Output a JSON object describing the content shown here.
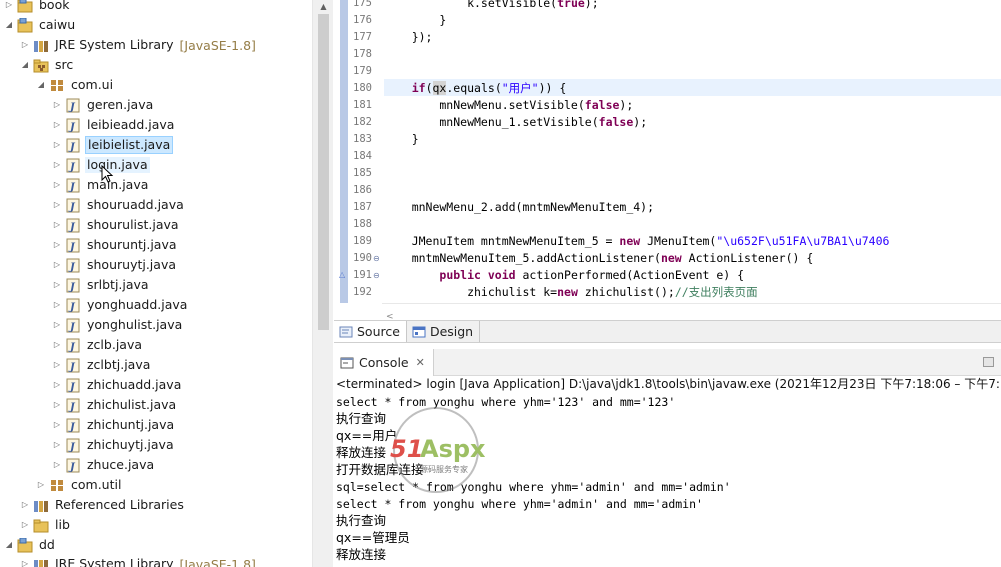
{
  "explorer": {
    "rows": [
      {
        "label": "book",
        "suffix": ""
      },
      {
        "label": "caiwu",
        "suffix": ""
      },
      {
        "label": "JRE System Library",
        "suffix": "[JavaSE-1.8]"
      },
      {
        "label": "src",
        "suffix": ""
      },
      {
        "label": "com.ui",
        "suffix": ""
      },
      {
        "label": "geren.java",
        "suffix": ""
      },
      {
        "label": "leibieadd.java",
        "suffix": ""
      },
      {
        "label": "leibielist.java",
        "suffix": ""
      },
      {
        "label": "login.java",
        "suffix": ""
      },
      {
        "label": "main.java",
        "suffix": ""
      },
      {
        "label": "shouruadd.java",
        "suffix": ""
      },
      {
        "label": "shourulist.java",
        "suffix": ""
      },
      {
        "label": "shouruntj.java",
        "suffix": ""
      },
      {
        "label": "shouruytj.java",
        "suffix": ""
      },
      {
        "label": "srlbtj.java",
        "suffix": ""
      },
      {
        "label": "yonghuadd.java",
        "suffix": ""
      },
      {
        "label": "yonghulist.java",
        "suffix": ""
      },
      {
        "label": "zclb.java",
        "suffix": ""
      },
      {
        "label": "zclbtj.java",
        "suffix": ""
      },
      {
        "label": "zhichuadd.java",
        "suffix": ""
      },
      {
        "label": "zhichulist.java",
        "suffix": ""
      },
      {
        "label": "zhichuntj.java",
        "suffix": ""
      },
      {
        "label": "zhichuytj.java",
        "suffix": ""
      },
      {
        "label": "zhuce.java",
        "suffix": ""
      },
      {
        "label": "com.util",
        "suffix": ""
      },
      {
        "label": "Referenced Libraries",
        "suffix": ""
      },
      {
        "label": "lib",
        "suffix": ""
      },
      {
        "label": "dd",
        "suffix": ""
      },
      {
        "label": "JRE System Library",
        "suffix": "[JavaSE-1.8]"
      }
    ]
  },
  "editor": {
    "line_numbers": [
      "175",
      "176",
      "177",
      "178",
      "179",
      "180",
      "181",
      "182",
      "183",
      "184",
      "185",
      "186",
      "187",
      "188",
      "189",
      "190",
      "191",
      "192"
    ]
  },
  "tabs": {
    "source": "Source",
    "design": "Design"
  },
  "console": {
    "tab_label": "Console",
    "close_glyph": "✕",
    "status": "<terminated> login [Java Application] D:\\java\\jdk1.8\\tools\\bin\\javaw.exe  (2021年12月23日 下午7:18:06 – 下午7:18:2",
    "lines": [
      "select * from yonghu where yhm='123' and mm='123'",
      "执行查询",
      "qx==用户",
      "释放连接",
      "打开数据库连接",
      "sql=select * from yonghu where yhm='admin' and mm='admin'",
      "select * from yonghu where yhm='admin' and mm='admin'",
      "执行查询",
      "qx==管理员",
      "释放连接"
    ]
  },
  "watermark": {
    "brand": "51Aspx",
    "tagline": "源码服务专家"
  },
  "colors": {
    "keyword": "#7f0055",
    "string": "#2a00ff",
    "comment": "#3f7f5f",
    "selection": "#cce8ff",
    "watermark_red": "#d9322b",
    "watermark_green": "#8db44a"
  }
}
